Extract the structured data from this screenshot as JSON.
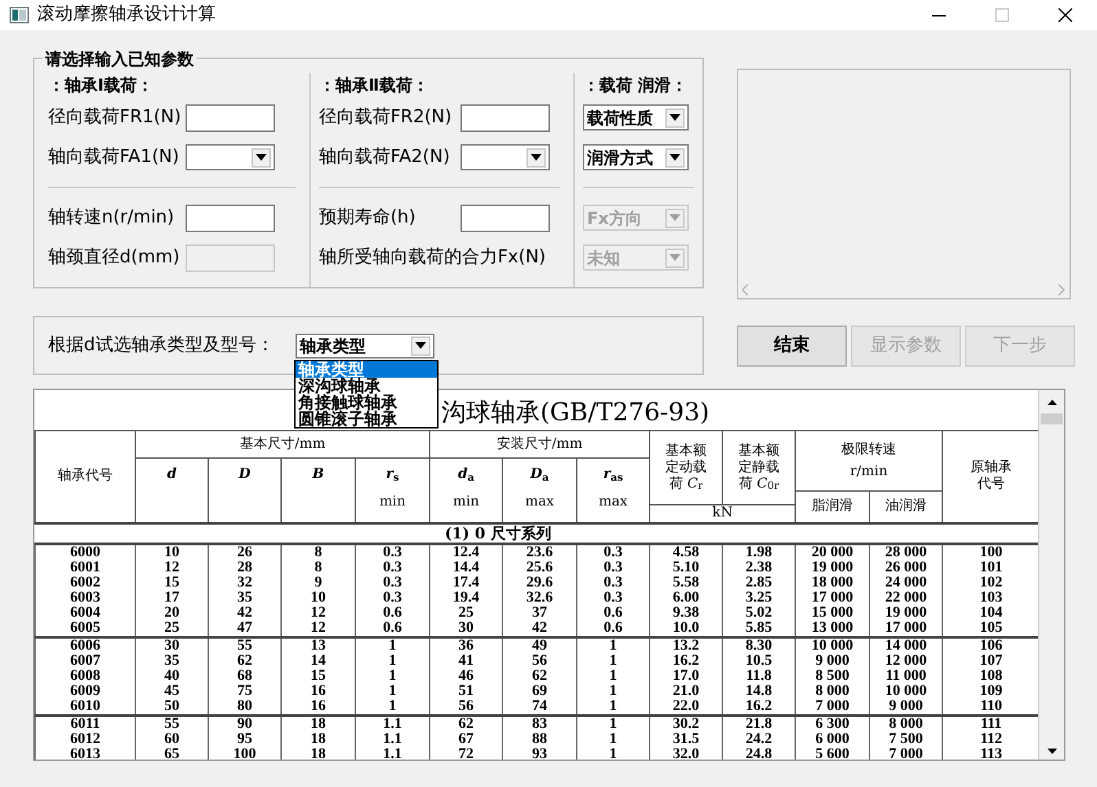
{
  "window": {
    "title": "滚动摩擦轴承设计计算",
    "maximize_disabled": true
  },
  "known_params": {
    "title": "请选择输入已知参数",
    "sections": [
      {
        "heading": "：轴承Ⅰ载荷：",
        "upper": [
          {
            "kind": "text",
            "label": "径向载荷FR1(N)",
            "disabled": false
          },
          {
            "kind": "combo",
            "label": "轴向载荷FA1(N)",
            "disabled": false
          }
        ],
        "lower": [
          {
            "kind": "text",
            "label": "轴转速n(r/min)",
            "disabled": false
          },
          {
            "kind": "text",
            "label": "轴颈直径d(mm)",
            "disabled": true
          }
        ]
      },
      {
        "heading": "：轴承Ⅱ载荷：",
        "upper": [
          {
            "kind": "text",
            "label": "径向载荷FR2(N)",
            "disabled": false
          },
          {
            "kind": "combo",
            "label": "轴向载荷FA2(N)",
            "disabled": false
          }
        ],
        "lower": [
          {
            "kind": "text",
            "label": "预期寿命(h)",
            "disabled": false
          },
          {
            "kind": "label",
            "label": "轴所受轴向载荷的合力Fx(N)"
          }
        ]
      },
      {
        "heading": "：载荷 润滑：",
        "upper": [
          {
            "kind": "combo",
            "value": "载荷性质",
            "disabled": false
          },
          {
            "kind": "combo",
            "value": "润滑方式",
            "disabled": false
          }
        ],
        "lower": [
          {
            "kind": "combo",
            "value": "Fx方向",
            "disabled": true
          },
          {
            "kind": "combo",
            "value": "未知",
            "disabled": true
          }
        ]
      }
    ]
  },
  "bearing_select": {
    "label": "根据d试选轴承类型及型号：",
    "value": "轴承类型",
    "expanded": true,
    "options": [
      {
        "label": "轴承类型",
        "selected": true
      },
      {
        "label": "深沟球轴承",
        "selected": false
      },
      {
        "label": "角接触球轴承",
        "selected": false
      },
      {
        "label": "圆锥滚子轴承",
        "selected": false
      }
    ]
  },
  "buttons": [
    {
      "label": "结束",
      "disabled": false
    },
    {
      "label": "显示参数",
      "disabled": true
    },
    {
      "label": "下一步",
      "disabled": true
    }
  ],
  "table": {
    "title": "沟球轴承(GB/T276-93)",
    "code_header": "轴承代号",
    "basic_header": "基本尺寸/mm",
    "mount_header": "安装尺寸/mm",
    "dim_columns": [
      {
        "symbol": "*d*"
      },
      {
        "symbol": "*D*"
      },
      {
        "symbol": "*B*"
      },
      {
        "symbol": "*r*$_{s}$",
        "note": "min"
      },
      {
        "symbol": "*d*$_{a}$",
        "note": "min"
      },
      {
        "symbol": "*D*$_{a}$",
        "note": "max"
      },
      {
        "symbol": "*r*$_{as}$",
        "note": "max"
      }
    ],
    "load_columns": [
      "基本额定动载荷 *C*$_{r}$",
      "基本额定静载荷 *C*$_{0r}$"
    ],
    "load_unit": "kN",
    "speed_header": "极限转速",
    "speed_unit": "r/min",
    "speed_columns": [
      "脂润滑",
      "油润滑"
    ],
    "old_code_header": "原轴承代号",
    "section": "(1) 0 尺寸系列",
    "rows": [
      {
        "cells": [
          "6000",
          "10",
          "26",
          "8",
          "0.3",
          "12.4",
          "23.6",
          "0.3",
          "4.58",
          "1.98",
          "20 000",
          "28 000",
          "100"
        ],
        "rule_below": false
      },
      {
        "cells": [
          "6001",
          "12",
          "28",
          "8",
          "0.3",
          "14.4",
          "25.6",
          "0.3",
          "5.10",
          "2.38",
          "19 000",
          "26 000",
          "101"
        ],
        "rule_below": false
      },
      {
        "cells": [
          "6002",
          "15",
          "32",
          "9",
          "0.3",
          "17.4",
          "29.6",
          "0.3",
          "5.58",
          "2.85",
          "18 000",
          "24 000",
          "102"
        ],
        "rule_below": false
      },
      {
        "cells": [
          "6003",
          "17",
          "35",
          "10",
          "0.3",
          "19.4",
          "32.6",
          "0.3",
          "6.00",
          "3.25",
          "17 000",
          "22 000",
          "103"
        ],
        "rule_below": false
      },
      {
        "cells": [
          "6004",
          "20",
          "42",
          "12",
          "0.6",
          "25",
          "37",
          "0.6",
          "9.38",
          "5.02",
          "15 000",
          "19 000",
          "104"
        ],
        "rule_below": false
      },
      {
        "cells": [
          "6005",
          "25",
          "47",
          "12",
          "0.6",
          "30",
          "42",
          "0.6",
          "10.0",
          "5.85",
          "13 000",
          "17 000",
          "105"
        ],
        "rule_below": true
      },
      {
        "cells": [
          "6006",
          "30",
          "55",
          "13",
          "1",
          "36",
          "49",
          "1",
          "13.2",
          "8.30",
          "10 000",
          "14 000",
          "106"
        ],
        "rule_below": false
      },
      {
        "cells": [
          "6007",
          "35",
          "62",
          "14",
          "1",
          "41",
          "56",
          "1",
          "16.2",
          "10.5",
          "9 000",
          "12 000",
          "107"
        ],
        "rule_below": false
      },
      {
        "cells": [
          "6008",
          "40",
          "68",
          "15",
          "1",
          "46",
          "62",
          "1",
          "17.0",
          "11.8",
          "8 500",
          "11 000",
          "108"
        ],
        "rule_below": false
      },
      {
        "cells": [
          "6009",
          "45",
          "75",
          "16",
          "1",
          "51",
          "69",
          "1",
          "21.0",
          "14.8",
          "8 000",
          "10 000",
          "109"
        ],
        "rule_below": false
      },
      {
        "cells": [
          "6010",
          "50",
          "80",
          "16",
          "1",
          "56",
          "74",
          "1",
          "22.0",
          "16.2",
          "7 000",
          "9 000",
          "110"
        ],
        "rule_below": true
      },
      {
        "cells": [
          "6011",
          "55",
          "90",
          "18",
          "1.1",
          "62",
          "83",
          "1",
          "30.2",
          "21.8",
          "6 300",
          "8 000",
          "111"
        ],
        "rule_below": false
      },
      {
        "cells": [
          "6012",
          "60",
          "95",
          "18",
          "1.1",
          "67",
          "88",
          "1",
          "31.5",
          "24.2",
          "6 000",
          "7 500",
          "112"
        ],
        "rule_below": false
      },
      {
        "cells": [
          "6013",
          "65",
          "100",
          "18",
          "1.1",
          "72",
          "93",
          "1",
          "32.0",
          "24.8",
          "5 600",
          "7 000",
          "113"
        ],
        "rule_below": false
      }
    ]
  }
}
